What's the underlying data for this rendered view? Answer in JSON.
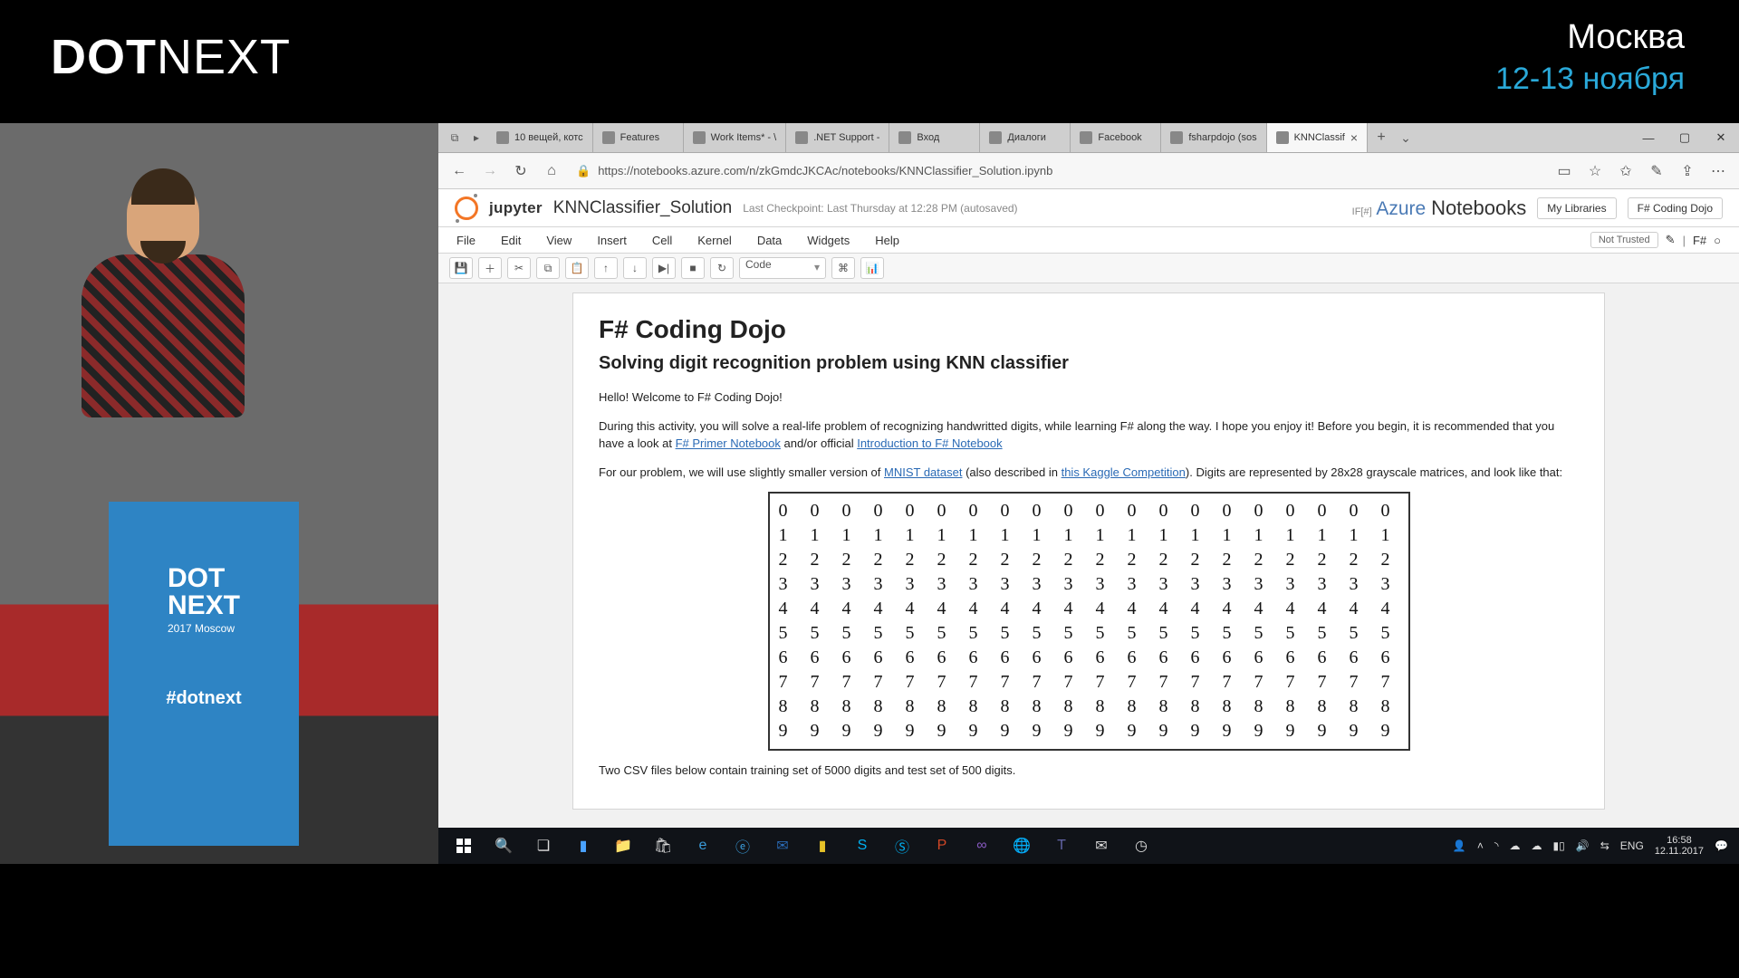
{
  "conference": {
    "logo_a": "DOT",
    "logo_b": "NEXT",
    "city": "Москва",
    "dates": "12-13 ноября",
    "podium_a": "DOT",
    "podium_b": "NEXT",
    "podium_sub": "2017 Moscow",
    "hashtag": "#dotnext"
  },
  "tabs": {
    "items": [
      {
        "label": "10 вещей, котс"
      },
      {
        "label": "Features"
      },
      {
        "label": "Work Items* - \\"
      },
      {
        "label": ".NET Support -"
      },
      {
        "label": "Вход"
      },
      {
        "label": "Диалоги"
      },
      {
        "label": "Facebook"
      },
      {
        "label": "fsharpdojo (sos"
      },
      {
        "label": "KNNClassif"
      }
    ]
  },
  "addr": {
    "url": "https://notebooks.azure.com/n/zkGmdcJKCAc/notebooks/KNNClassifier_Solution.ipynb"
  },
  "jup": {
    "brand": "jupyter",
    "nbname": "KNNClassifier_Solution",
    "checkpoint": "Last Checkpoint: Last Thursday at 12:28 PM (autosaved)",
    "ifsharp": "IF[#]",
    "azure_a": "Azure",
    "azure_b": "Notebooks",
    "my_lib": "My Libraries",
    "crumb": "F# Coding Dojo",
    "menus": [
      "File",
      "Edit",
      "View",
      "Insert",
      "Cell",
      "Kernel",
      "Data",
      "Widgets",
      "Help"
    ],
    "trust": "Not Trusted",
    "kernel": "F#",
    "celltype": "Code"
  },
  "doc": {
    "h1": "F# Coding Dojo",
    "h2": "Solving digit recognition problem using KNN classifier",
    "p1": "Hello! Welcome to F# Coding Dojo!",
    "p2a": "During this activity, you will solve a real-life problem of recognizing handwritted digits, while learning F# along the way. I hope you enjoy it! Before you begin, it is recommended that you have a look at ",
    "p2link1": "F# Primer Notebook",
    "p2b": " and/or official ",
    "p2link2": "Introduction to F# Notebook",
    "p3a": "For our problem, we will use slightly smaller version of ",
    "p3link1": "MNIST dataset",
    "p3b": " (also described in ",
    "p3link2": "this Kaggle Competition",
    "p3c": "). Digits are represented by 28x28 grayscale matrices, and look like that:",
    "p4": "Two CSV files below contain training set of 5000 digits and test set of 500 digits.",
    "mnist_rows": [
      "0 0 0 0 0 0 0 0 0 0 0 0 0 0 0 0 0 0 0 0",
      "1 1 1 1 1 1 1 1 1 1 1 1 1 1 1 1 1 1 1 1",
      "2 2 2 2 2 2 2 2 2 2 2 2 2 2 2 2 2 2 2 2",
      "3 3 3 3 3 3 3 3 3 3 3 3 3 3 3 3 3 3 3 3",
      "4 4 4 4 4 4 4 4 4 4 4 4 4 4 4 4 4 4 4 4",
      "5 5 5 5 5 5 5 5 5 5 5 5 5 5 5 5 5 5 5 5",
      "6 6 6 6 6 6 6 6 6 6 6 6 6 6 6 6 6 6 6 6",
      "7 7 7 7 7 7 7 7 7 7 7 7 7 7 7 7 7 7 7 7",
      "8 8 8 8 8 8 8 8 8 8 8 8 8 8 8 8 8 8 8 8",
      "9 9 9 9 9 9 9 9 9 9 9 9 9 9 9 9 9 9 9 9"
    ]
  },
  "tray": {
    "lang": "ENG",
    "time": "16:58",
    "date": "12.11.2017"
  }
}
